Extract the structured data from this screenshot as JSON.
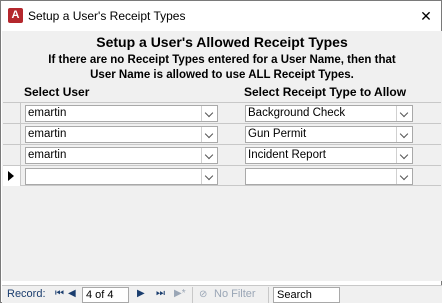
{
  "window": {
    "title": "Setup a User's Receipt Types",
    "icon_letter": "A",
    "close_glyph": "✕"
  },
  "form": {
    "heading": "Setup a User's Allowed Receipt Types",
    "note_line1": "If there are no Receipt Types entered for a User Name, then that",
    "note_line2": "User Name is allowed to use ALL Receipt Types.",
    "col_user": "Select User",
    "col_type": "Select Receipt Type to Allow",
    "rows": [
      {
        "user": "emartin",
        "type": "Background Check"
      },
      {
        "user": "emartin",
        "type": "Gun Permit"
      },
      {
        "user": "emartin",
        "type": "Incident Report"
      },
      {
        "user": "",
        "type": ""
      }
    ]
  },
  "navigation": {
    "record_label": "Record:",
    "first": "⏮",
    "prev": "◀",
    "position": "4 of 4",
    "next": "▶",
    "last": "⏭",
    "new": "▶*",
    "filter_label": "No Filter",
    "filter_icon": "🔍",
    "search_value": "Search"
  },
  "colors": {
    "access_red": "#b4272d",
    "nav_text": "#1a3d6e"
  }
}
